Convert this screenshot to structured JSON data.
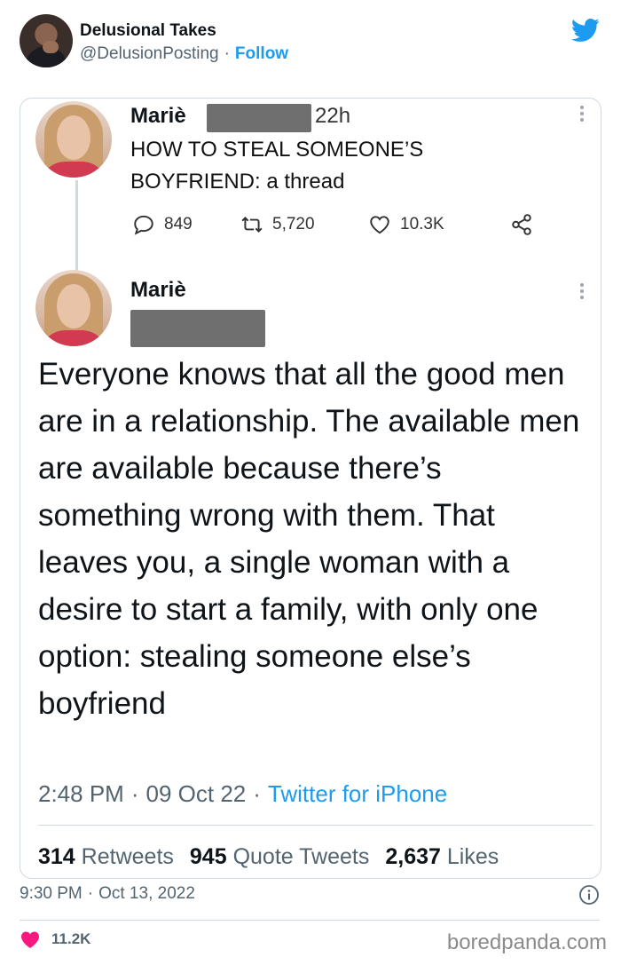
{
  "outer_tweet": {
    "display_name": "Delusional Takes",
    "handle": "@DelusionPosting",
    "separator": "·",
    "follow_label": "Follow",
    "timestamp_time": "9:30 PM",
    "timestamp_date": "Oct 13, 2022",
    "likes": "11.2K"
  },
  "tweet1": {
    "name": "Mariè",
    "time": "22h",
    "text": "HOW TO STEAL SOMEONE’S BOYFRIEND: a thread",
    "replies": "849",
    "retweets": "5,720",
    "likes": "10.3K"
  },
  "tweet2": {
    "name": "Mariè",
    "text": "Everyone knows that all the good men are in a relationship. The available men are available because there’s something wrong with them. That leaves you, a single woman with a desire to start a family, with only one option: stealing someone else’s boyfriend",
    "time": "2:48 PM",
    "date": "09 Oct 22",
    "source": "Twitter for iPhone",
    "retweets_count": "314",
    "retweets_label": "Retweets",
    "quotes_count": "945",
    "quotes_label": "Quote Tweets",
    "likes_count": "2,637",
    "likes_label": "Likes"
  },
  "watermark": "boredpanda.com",
  "colors": {
    "twitter_blue": "#1d9bf0",
    "like_pink": "#f91880",
    "muted_text": "#536471",
    "border": "#cfd9de"
  },
  "icons": [
    "twitter-logo-icon",
    "reply-icon",
    "retweet-icon",
    "like-icon",
    "share-icon",
    "more-icon",
    "info-icon",
    "heart-icon"
  ]
}
